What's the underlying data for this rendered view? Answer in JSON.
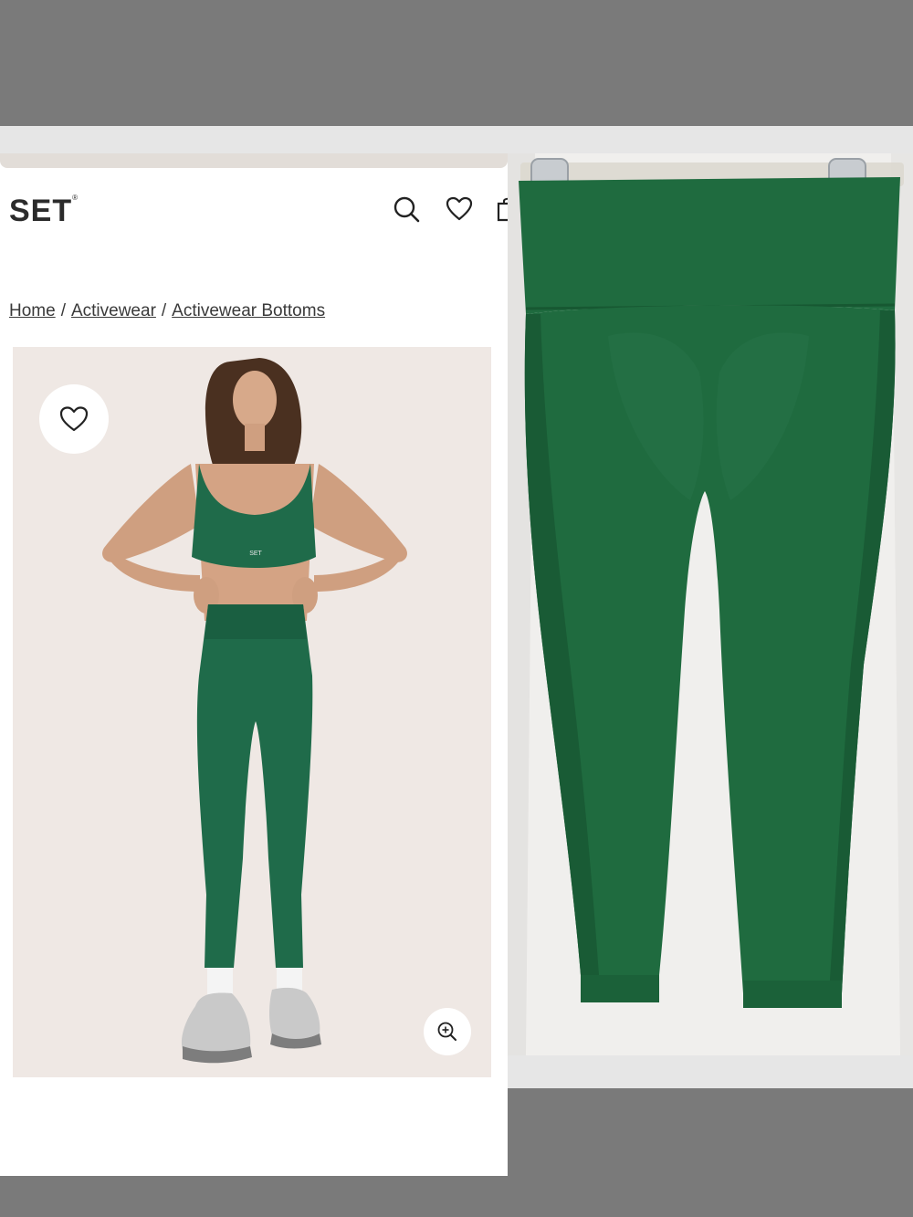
{
  "store": {
    "brand": "SET",
    "brand_mark": "®",
    "header_icons": [
      "search-icon",
      "heart-icon",
      "bag-icon"
    ],
    "breadcrumb": {
      "items": [
        "Home",
        "Activewear",
        "Activewear Bottoms"
      ],
      "separator": "/"
    },
    "hero": {
      "favorite_icon": "heart-icon",
      "zoom_icon": "zoom-in-icon",
      "bra_logo": "SET"
    }
  },
  "colors": {
    "garment_green": "#1f6b4a",
    "hero_background": "#efe8e4",
    "frame_gray": "#7a7a7a"
  }
}
